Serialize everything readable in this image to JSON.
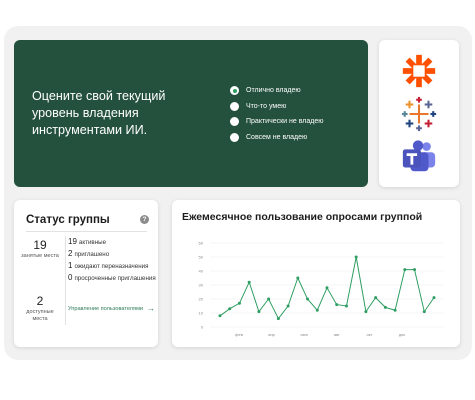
{
  "survey": {
    "question": "Оцените свой текущий уровень владения инструментами ИИ.",
    "options": [
      {
        "label": "Отлично владею",
        "checked": true
      },
      {
        "label": "Что-то умею",
        "checked": false
      },
      {
        "label": "Практически не владею",
        "checked": false
      },
      {
        "label": "Совсем не владею",
        "checked": false
      }
    ]
  },
  "apps": {
    "items": [
      {
        "name": "Zapier",
        "icon": "zapier-icon",
        "color": "#ff4f00"
      },
      {
        "name": "Tableau",
        "icon": "tableau-icon",
        "color": "#e8762d"
      },
      {
        "name": "Microsoft Teams",
        "icon": "teams-icon",
        "color": "#5059c9"
      }
    ]
  },
  "group_status": {
    "title": "Статус группы",
    "help_icon": "?",
    "occupied": {
      "count": "19",
      "label": "занятые места"
    },
    "available": {
      "count": "2",
      "label": "доступные места"
    },
    "stats": [
      {
        "count": "19",
        "label": "активные"
      },
      {
        "count": "2",
        "label": "приглашено"
      },
      {
        "count": "1",
        "label": "ожидают переназначения"
      },
      {
        "count": "0",
        "label": "просроченные приглашения"
      }
    ],
    "manage_link": "Управление пользователями",
    "manage_arrow": "→"
  },
  "chart_data": {
    "type": "line",
    "title": "Ежемесячное пользование опросами группой",
    "y_ticks": [
      "60",
      "50",
      "40",
      "30",
      "20",
      "10",
      "0"
    ],
    "ylim": [
      0,
      60
    ],
    "x_ticks": [
      "фев",
      "апр",
      "июн",
      "авг",
      "окт",
      "дек"
    ],
    "grid": true,
    "color": "#2e9e62",
    "series": [
      {
        "values": [
          8,
          13,
          17,
          32,
          11,
          20,
          6,
          15,
          35,
          20,
          12,
          28,
          16,
          15,
          50,
          11,
          21,
          14,
          12,
          41,
          41,
          11,
          21
        ]
      }
    ]
  }
}
